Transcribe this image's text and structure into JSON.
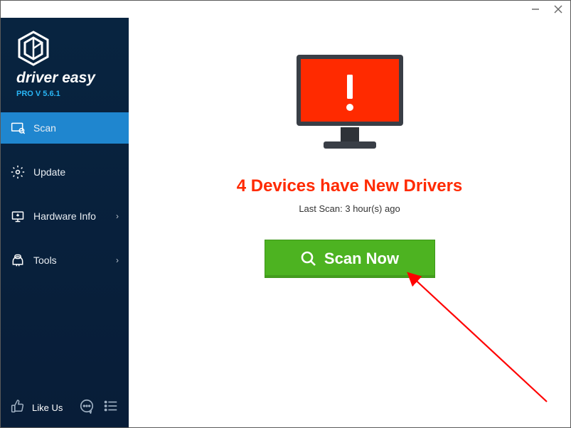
{
  "titlebar": {
    "minimize_tip": "Minimize",
    "close_tip": "Close"
  },
  "brand": {
    "name": "driver easy",
    "sub": "PRO V 5.6.1"
  },
  "sidebar": {
    "items": [
      {
        "id": "scan",
        "label": "Scan",
        "icon": "scan-icon",
        "active": true,
        "expandable": false
      },
      {
        "id": "update",
        "label": "Update",
        "icon": "update-icon",
        "active": false,
        "expandable": false
      },
      {
        "id": "hardware",
        "label": "Hardware Info",
        "icon": "hardware-icon",
        "active": false,
        "expandable": true
      },
      {
        "id": "tools",
        "label": "Tools",
        "icon": "tools-icon",
        "active": false,
        "expandable": true
      }
    ],
    "like_label": "Like Us"
  },
  "main": {
    "headline": "4 Devices have New Drivers",
    "subline": "Last Scan: 3 hour(s) ago",
    "scan_label": "Scan Now"
  },
  "colors": {
    "sidebar_bg": "#082440",
    "sidebar_active": "#1f86cf",
    "brand_sub": "#29b6f6",
    "headline": "#ff2a00",
    "button_bg": "#4db321",
    "monitor": "#ff2a00",
    "monitor_frame": "#393e46",
    "arrow": "#ff0000"
  }
}
